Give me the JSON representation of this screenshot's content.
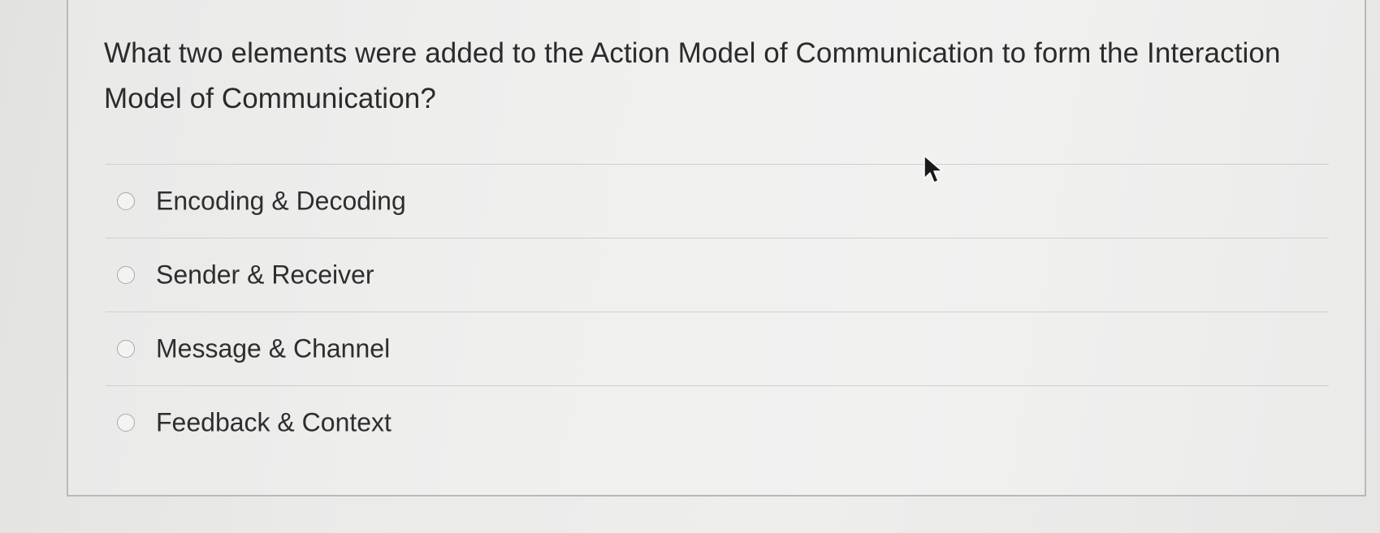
{
  "question": {
    "text": "What two elements were added to the Action Model of Communication to form the Interaction Model of Communication?"
  },
  "options": [
    {
      "label": "Encoding & Decoding",
      "selected": false
    },
    {
      "label": "Sender & Receiver",
      "selected": false
    },
    {
      "label": "Message & Channel",
      "selected": false
    },
    {
      "label": "Feedback & Context",
      "selected": false
    }
  ],
  "icons": {
    "cursor": "mouse-pointer-icon",
    "radio": "radio-unchecked-icon"
  },
  "colors": {
    "text": "#2b2b2b",
    "divider": "#cfcfcd",
    "radio_border": "#a9a9a7"
  }
}
